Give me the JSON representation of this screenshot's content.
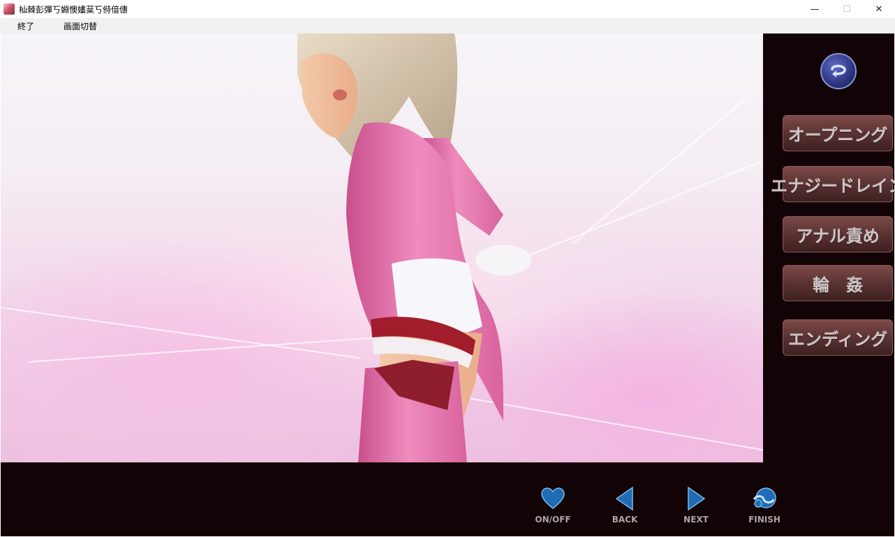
{
  "window": {
    "title": "杣棘彭彈丂婣懊嫿棻丂偫偣僡",
    "controls": {
      "minimize": "—",
      "maximize": "☐",
      "close": "✕"
    }
  },
  "menu": {
    "items": [
      "終了",
      "画面切替"
    ]
  },
  "side_panel": {
    "return_icon": "return-arrow-icon",
    "scenes": [
      "オープニング",
      "エナジードレイン",
      "アナル責め",
      "輪　姦",
      "エンディング"
    ]
  },
  "controls": {
    "on_off": "ON/OFF",
    "back": "BACK",
    "next": "NEXT",
    "finish": "FINISH"
  },
  "colors": {
    "panel_bg": "#120406",
    "scene_button": "#5d3434",
    "icon_blue": "#1f6cb5"
  }
}
